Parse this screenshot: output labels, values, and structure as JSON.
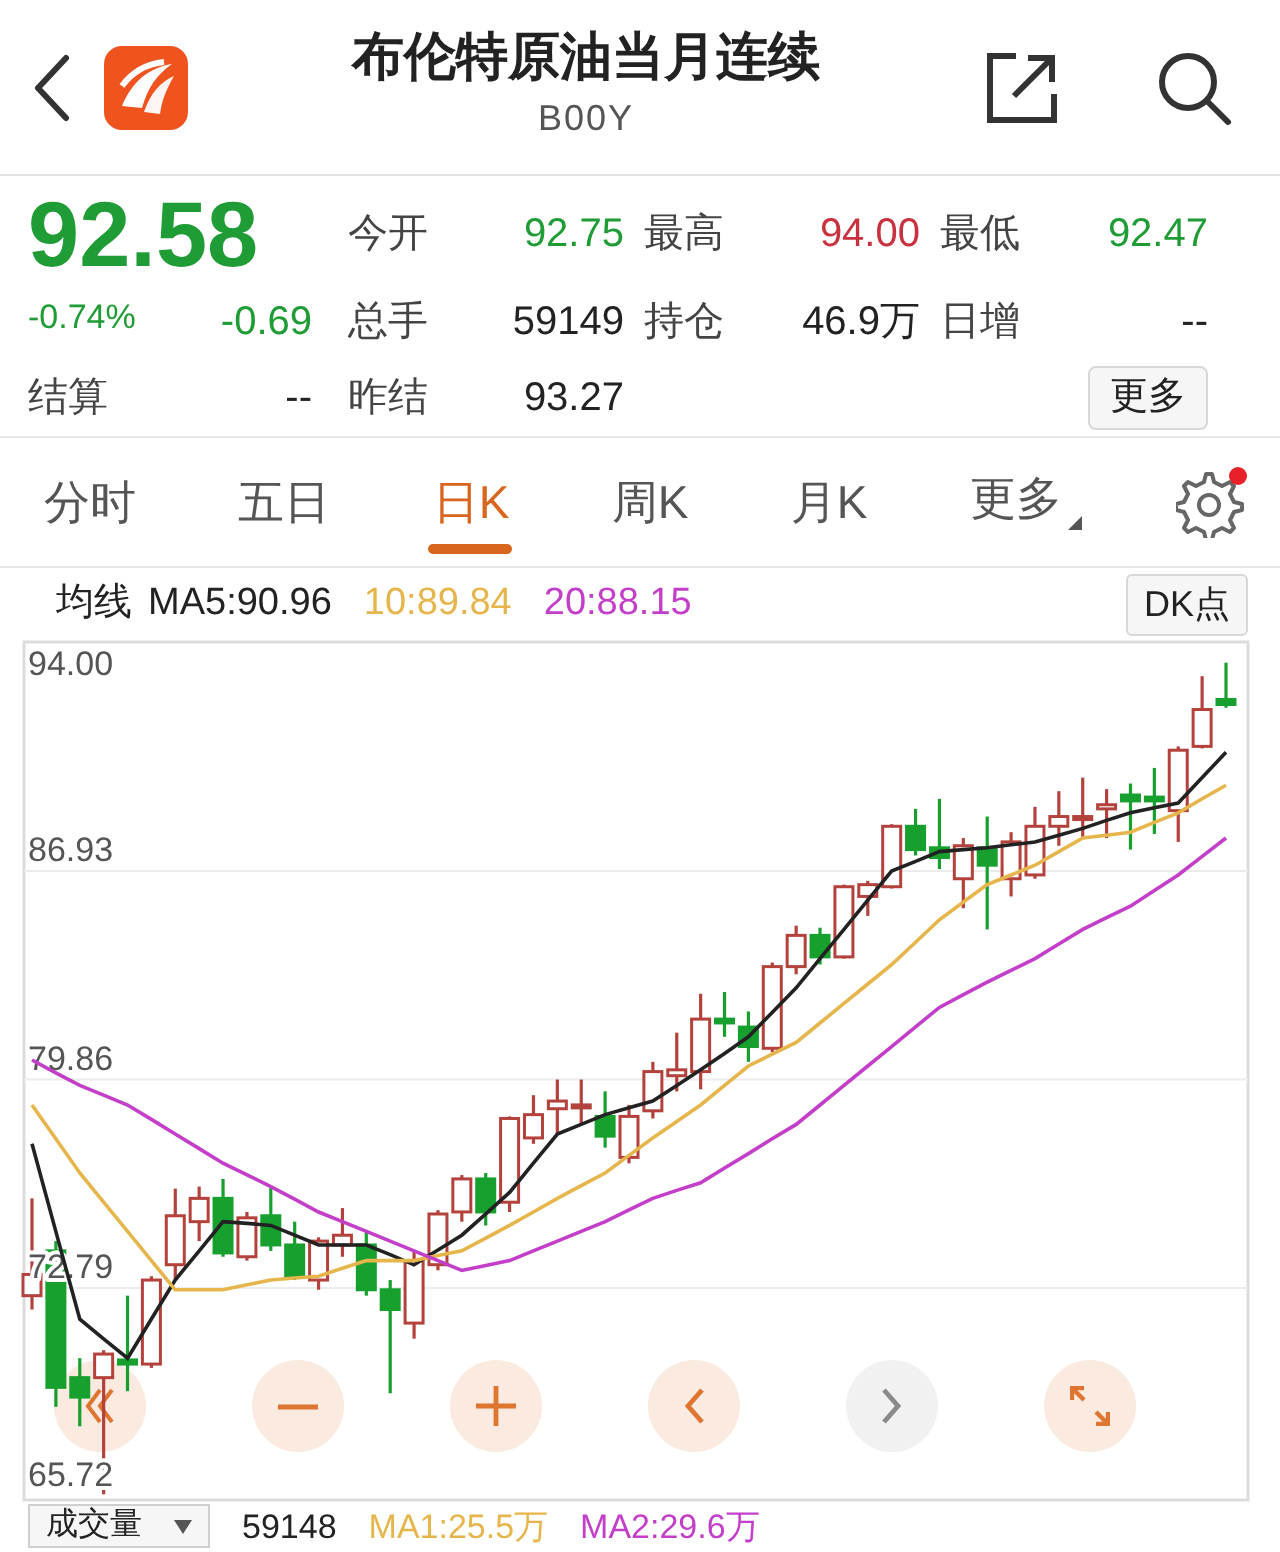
{
  "header": {
    "title": "布伦特原油当月连续",
    "subtitle": "B00Y"
  },
  "quote": {
    "price": "92.58",
    "color": "#1f9c35",
    "change_pct": "-0.74%",
    "change": "-0.69",
    "fields": [
      {
        "label": "今开",
        "value": "92.75",
        "color": "#1f9c35"
      },
      {
        "label": "最高",
        "value": "94.00",
        "color": "#c9313f"
      },
      {
        "label": "最低",
        "value": "92.47",
        "color": "#1f9c35"
      },
      {
        "label": "总手",
        "value": "59149",
        "color": "#222222"
      },
      {
        "label": "持仓",
        "value": "46.9万",
        "color": "#222222"
      },
      {
        "label": "日增",
        "value": "--",
        "color": "#222222"
      },
      {
        "label": "昨结",
        "value": "93.27",
        "color": "#222222"
      }
    ],
    "settle": {
      "label": "结算",
      "value": "--"
    },
    "more_button": "更多"
  },
  "tabs": [
    {
      "label": "分时",
      "selected": false,
      "kind": "plain"
    },
    {
      "label": "五日",
      "selected": false,
      "kind": "plain"
    },
    {
      "label": "日K",
      "selected": true,
      "kind": "plain"
    },
    {
      "label": "周K",
      "selected": false,
      "kind": "plain"
    },
    {
      "label": "月K",
      "selected": false,
      "kind": "plain"
    },
    {
      "label": "更多",
      "selected": false,
      "kind": "menu"
    }
  ],
  "settings": {
    "notification": true
  },
  "ma_legend": {
    "label": "均线",
    "button": "DK点"
  },
  "chart_data": {
    "type": "candlestick",
    "ylim": [
      65.6,
      94.7
    ],
    "grid": true,
    "yticks": [
      {
        "value": 94.0,
        "label": "94.00"
      },
      {
        "value": 86.93,
        "label": "86.93"
      },
      {
        "value": 79.86,
        "label": "79.86"
      },
      {
        "value": 72.79,
        "label": "72.79"
      },
      {
        "value": 65.72,
        "label": "65.72"
      }
    ],
    "ohlc": [
      [
        72.53,
        75.83,
        72.06,
        73.25
      ],
      [
        74.05,
        74.38,
        68.76,
        69.42
      ],
      [
        69.75,
        70.41,
        68.1,
        69.09
      ],
      [
        69.75,
        70.68,
        65.79,
        70.55
      ],
      [
        70.35,
        72.53,
        69.29,
        70.21
      ],
      [
        70.21,
        73.19,
        70.08,
        73.06
      ],
      [
        73.58,
        76.16,
        73.06,
        75.24
      ],
      [
        75.04,
        76.23,
        74.38,
        75.83
      ],
      [
        75.83,
        76.49,
        73.85,
        73.98
      ],
      [
        73.85,
        75.37,
        73.72,
        75.17
      ],
      [
        75.24,
        76.23,
        74.05,
        74.25
      ],
      [
        74.25,
        75.04,
        73.06,
        73.19
      ],
      [
        73.06,
        74.51,
        72.73,
        74.38
      ],
      [
        74.25,
        75.5,
        73.85,
        74.58
      ],
      [
        74.25,
        74.71,
        72.53,
        72.73
      ],
      [
        72.73,
        73.06,
        69.22,
        72.06
      ],
      [
        71.6,
        74.05,
        71.07,
        73.72
      ],
      [
        73.58,
        75.43,
        73.39,
        75.3
      ],
      [
        75.37,
        76.62,
        75.04,
        76.49
      ],
      [
        76.49,
        76.69,
        74.91,
        75.37
      ],
      [
        75.7,
        78.61,
        75.37,
        78.54
      ],
      [
        77.88,
        79.33,
        77.68,
        78.67
      ],
      [
        78.87,
        79.86,
        78.01,
        79.13
      ],
      [
        78.94,
        79.86,
        78.34,
        79.0
      ],
      [
        78.61,
        79.46,
        77.55,
        77.94
      ],
      [
        77.22,
        79.0,
        77.02,
        78.61
      ],
      [
        78.8,
        80.46,
        78.54,
        80.13
      ],
      [
        79.99,
        81.45,
        79.46,
        80.19
      ],
      [
        80.13,
        82.77,
        79.53,
        81.91
      ],
      [
        81.91,
        82.83,
        81.31,
        81.78
      ],
      [
        81.64,
        82.17,
        80.46,
        80.98
      ],
      [
        80.92,
        83.83,
        80.79,
        83.69
      ],
      [
        83.69,
        85.08,
        83.43,
        84.75
      ],
      [
        84.75,
        85.01,
        83.76,
        84.02
      ],
      [
        84.02,
        86.47,
        83.96,
        86.4
      ],
      [
        86.07,
        86.6,
        85.41,
        86.47
      ],
      [
        86.4,
        88.52,
        86.34,
        88.45
      ],
      [
        88.45,
        89.04,
        87.46,
        87.66
      ],
      [
        87.72,
        89.38,
        87.0,
        87.39
      ],
      [
        86.67,
        88.05,
        85.67,
        87.79
      ],
      [
        87.72,
        88.78,
        84.95,
        87.13
      ],
      [
        86.67,
        88.25,
        86.07,
        87.92
      ],
      [
        86.8,
        89.11,
        86.67,
        88.45
      ],
      [
        88.45,
        89.64,
        87.79,
        88.78
      ],
      [
        88.71,
        90.1,
        88.05,
        88.78
      ],
      [
        89.04,
        89.71,
        88.05,
        89.18
      ],
      [
        89.51,
        89.9,
        87.66,
        89.31
      ],
      [
        89.44,
        90.43,
        88.19,
        89.31
      ],
      [
        88.98,
        91.16,
        87.92,
        91.03
      ],
      [
        91.16,
        93.54,
        91.09,
        92.41
      ],
      [
        92.75,
        94.0,
        92.47,
        92.58
      ]
    ]
  },
  "ma_overlay": {
    "chart_data": {
      "type": "line",
      "ylim": [
        65.6,
        94.7
      ],
      "series": [
        {
          "name": "MA5:90.96",
          "color": "#222222",
          "values": [
            77.68,
            74.71,
            71.73,
            71.07,
            70.41,
            71.74,
            73.06,
            74.05,
            75.04,
            74.98,
            74.91,
            74.58,
            74.25,
            74.25,
            74.25,
            73.92,
            73.58,
            74.08,
            74.58,
            75.31,
            76.03,
            77.02,
            78.01,
            78.34,
            78.67,
            78.9,
            79.13,
            79.66,
            80.19,
            80.75,
            81.31,
            82.14,
            82.97,
            83.96,
            84.95,
            85.94,
            86.93,
            87.26,
            87.59,
            87.66,
            87.72,
            87.82,
            87.92,
            88.15,
            88.38,
            88.65,
            88.91,
            89.08,
            89.24,
            90.1,
            90.96
          ]
        },
        {
          "name": "10:89.84",
          "color": "#e6b64c",
          "values": [
            79.0,
            77.85,
            76.69,
            75.7,
            74.71,
            73.72,
            72.73,
            72.73,
            72.73,
            72.9,
            73.06,
            73.13,
            73.19,
            73.46,
            73.72,
            73.72,
            73.72,
            73.89,
            74.05,
            74.48,
            74.91,
            75.37,
            75.83,
            76.26,
            76.69,
            77.29,
            77.88,
            78.44,
            79.0,
            79.66,
            80.32,
            80.72,
            81.12,
            81.78,
            82.44,
            83.1,
            83.76,
            84.52,
            85.28,
            85.88,
            86.47,
            86.8,
            87.13,
            87.59,
            88.05,
            88.15,
            88.25,
            88.58,
            88.91,
            89.38,
            89.84
          ]
        },
        {
          "name": "20:88.15",
          "color": "#c43fc9",
          "values": [
            80.52,
            80.09,
            79.66,
            79.33,
            79.0,
            78.51,
            78.01,
            77.52,
            77.02,
            76.63,
            76.23,
            75.8,
            75.37,
            75.04,
            74.71,
            74.38,
            74.05,
            73.72,
            73.39,
            73.56,
            73.72,
            74.05,
            74.38,
            74.71,
            75.04,
            75.44,
            75.83,
            76.1,
            76.36,
            76.86,
            77.35,
            77.85,
            78.34,
            79.0,
            79.66,
            80.32,
            80.98,
            81.65,
            82.31,
            82.74,
            83.16,
            83.56,
            83.96,
            84.46,
            84.95,
            85.35,
            85.74,
            86.27,
            86.8,
            87.43,
            88.05
          ]
        }
      ]
    }
  },
  "chart_controls": [
    {
      "kind": "first",
      "disabled": false
    },
    {
      "kind": "zoom_out",
      "disabled": false
    },
    {
      "kind": "zoom_in",
      "disabled": false
    },
    {
      "kind": "prev",
      "disabled": false
    },
    {
      "kind": "next",
      "disabled": true
    },
    {
      "kind": "expand",
      "disabled": false
    }
  ],
  "volume_bar": {
    "selector": "成交量",
    "value": "59148",
    "items": [
      {
        "text": "MA1:25.5万",
        "color": "#e6b64c"
      },
      {
        "text": "MA2:29.6万",
        "color": "#c43fc9"
      }
    ]
  }
}
